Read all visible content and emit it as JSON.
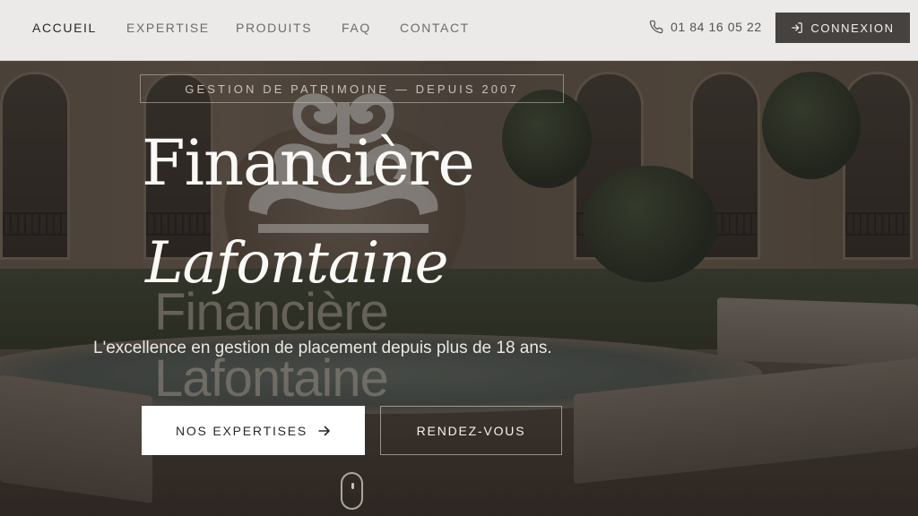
{
  "nav": {
    "links": [
      {
        "label": "ACCUEIL",
        "active": true
      },
      {
        "label": "EXPERTISE",
        "active": false
      },
      {
        "label": "PRODUITS",
        "active": false
      },
      {
        "label": "FAQ",
        "active": false
      },
      {
        "label": "CONTACT",
        "active": false
      }
    ],
    "phone": {
      "icon": "phone-icon",
      "number": "01 84 16 05 22"
    },
    "login": {
      "icon": "login-icon",
      "label": "CONNEXION"
    }
  },
  "hero": {
    "tagline": "GESTION DE PATRIMOINE — DEPUIS 2007",
    "title_line1": "Financière",
    "title_line2": "Lafontaine",
    "ghost_line1": "Financière",
    "ghost_line2": "Lafontaine",
    "subtitle": "L'excellence en gestion de placement depuis plus de 18 ans.",
    "primary_button": {
      "label": "NOS EXPERTISES",
      "icon": "arrow-right-icon"
    },
    "secondary_button": {
      "label": "RENDEZ-VOUS"
    },
    "scroll_indicator": {
      "icon": "mouse-scroll-icon"
    }
  },
  "colors": {
    "nav_bg": "#eceae9",
    "login_bg": "#454240",
    "primary_button_bg": "#ffffff",
    "title_text": "#fbf9f6"
  }
}
